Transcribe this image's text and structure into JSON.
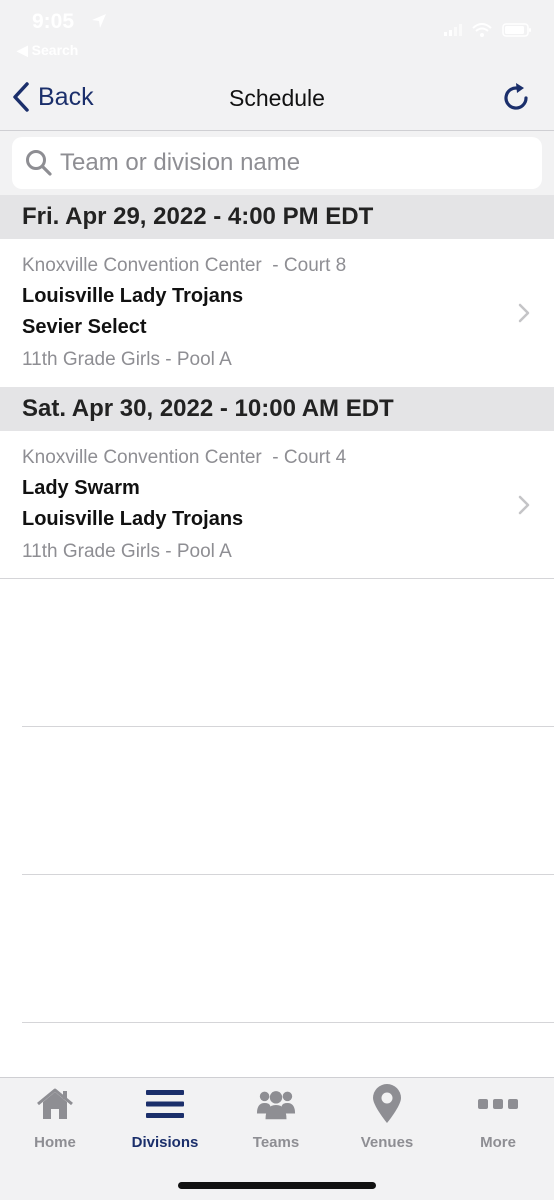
{
  "status_bar": {
    "time": "9:05",
    "back_app": "◀ Search"
  },
  "nav": {
    "back_label": "Back",
    "title": "Schedule"
  },
  "search": {
    "placeholder": "Team or division name",
    "value": ""
  },
  "schedule": [
    {
      "date_header": "Fri. Apr 29, 2022 - 4:00 PM EDT",
      "venue": "Knoxville Convention Center  - Court 8",
      "team1": "Louisville Lady Trojans",
      "team2": "Sevier Select",
      "division": "11th Grade Girls - Pool A"
    },
    {
      "date_header": "Sat. Apr 30, 2022 - 10:00 AM EDT",
      "venue": "Knoxville Convention Center  - Court 4",
      "team1": "Lady Swarm",
      "team2": "Louisville Lady Trojans",
      "division": "11th Grade Girls - Pool A"
    }
  ],
  "tab_bar": {
    "active": "Divisions",
    "tabs": [
      {
        "label": "Home",
        "icon": "house-icon"
      },
      {
        "label": "Divisions",
        "icon": "menu-bars-icon"
      },
      {
        "label": "Teams",
        "icon": "people-icon"
      },
      {
        "label": "Venues",
        "icon": "location-pin-icon"
      },
      {
        "label": "More",
        "icon": "more-dots-icon"
      }
    ]
  },
  "colors": {
    "accent": "#1b2f6b",
    "inactive": "#8e8e93",
    "section_bg": "#e4e4e6",
    "bar_bg": "#f2f2f3"
  }
}
